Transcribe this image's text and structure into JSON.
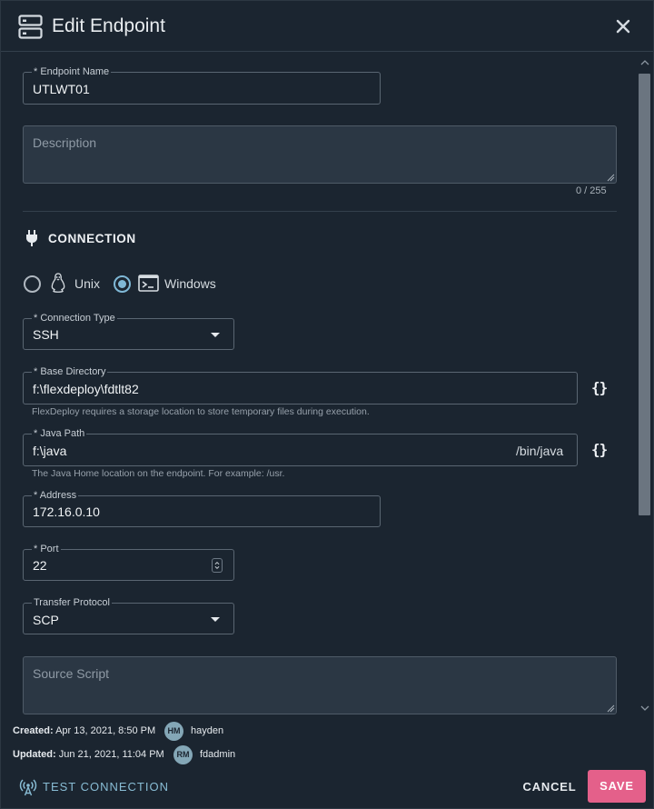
{
  "dialog": {
    "title": "Edit Endpoint",
    "close_icon": "close-icon",
    "header_icon": "server-icon"
  },
  "form": {
    "endpoint_name": {
      "label": "* Endpoint Name",
      "value": "UTLWT01"
    },
    "description": {
      "placeholder": "Description",
      "counter": "0 / 255"
    },
    "connection_section": {
      "title": "CONNECTION",
      "icon": "plug-icon"
    },
    "os": {
      "options": [
        {
          "label": "Unix",
          "icon": "linux-icon",
          "selected": false
        },
        {
          "label": "Windows",
          "icon": "terminal-icon",
          "selected": true
        }
      ]
    },
    "connection_type": {
      "label": "* Connection Type",
      "value": "SSH"
    },
    "base_directory": {
      "label": "* Base Directory",
      "value": "f:\\flexdeploy\\fdtlt82",
      "helper": "FlexDeploy requires a storage location to store temporary files during execution.",
      "variable_button": "{}"
    },
    "java_path": {
      "label": "* Java Path",
      "value": "f:\\java",
      "suffix": "/bin/java",
      "helper": "The Java Home location on the endpoint. For example: /usr.",
      "variable_button": "{}"
    },
    "address": {
      "label": "* Address",
      "value": "172.16.0.10"
    },
    "port": {
      "label": "* Port",
      "value": "22"
    },
    "transfer_protocol": {
      "label": "Transfer Protocol",
      "value": "SCP"
    },
    "source_script": {
      "placeholder": "Source Script"
    }
  },
  "footer": {
    "created": {
      "label": "Created:",
      "date": "Apr 13, 2021, 8:50 PM",
      "initials": "HM",
      "user": "hayden"
    },
    "updated": {
      "label": "Updated:",
      "date": "Jun 21, 2021, 11:04 PM",
      "initials": "RM",
      "user": "fdadmin"
    },
    "test_connection": "TEST CONNECTION",
    "cancel": "CANCEL",
    "save": "SAVE"
  },
  "colors": {
    "background": "#1b2530",
    "accent": "#7fb8d6",
    "save": "#e4608a"
  }
}
